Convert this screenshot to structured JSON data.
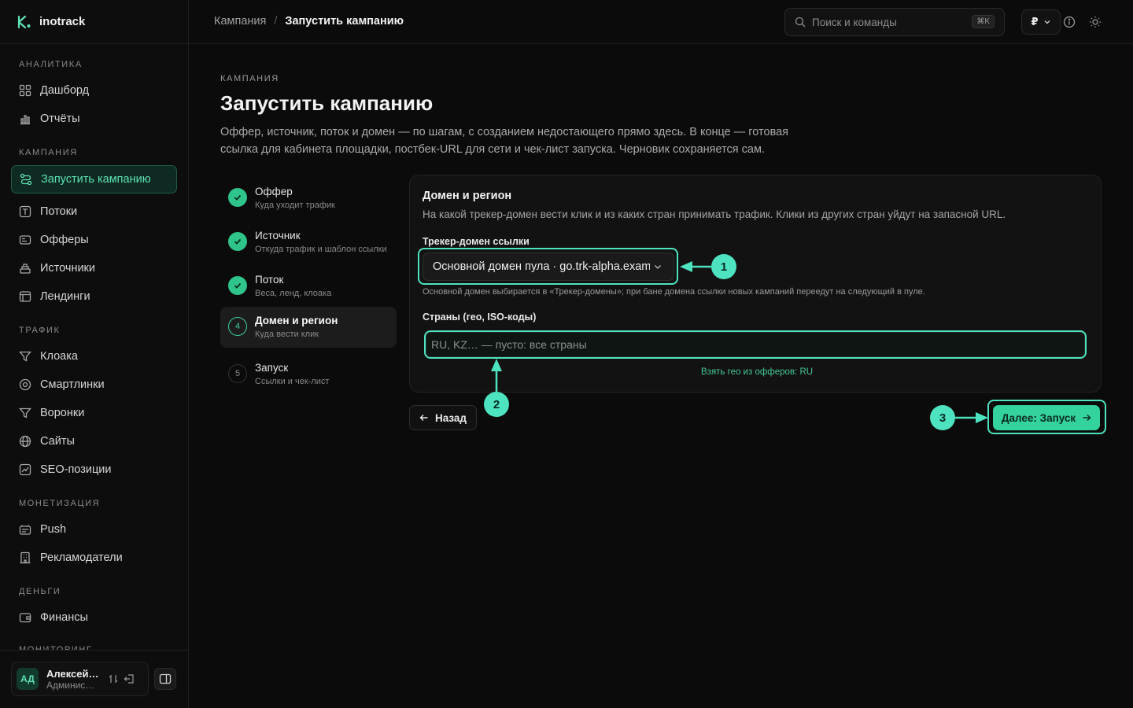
{
  "app": {
    "name": "inotrack"
  },
  "breadcrumb": {
    "parent": "Кампания",
    "separator": "/",
    "current": "Запустить кампанию"
  },
  "search": {
    "placeholder": "Поиск и команды",
    "shortcut": "⌘K"
  },
  "currency": {
    "symbol": "₽"
  },
  "sidebar": {
    "sections": [
      {
        "label": "АНАЛИТИКА",
        "items": [
          {
            "label": "Дашборд",
            "icon": "dashboard-icon"
          },
          {
            "label": "Отчёты",
            "icon": "reports-icon"
          }
        ]
      },
      {
        "label": "КАМПАНИЯ",
        "items": [
          {
            "label": "Запустить кампанию",
            "icon": "route-icon",
            "active": true
          },
          {
            "label": "Потоки",
            "icon": "streams-icon"
          },
          {
            "label": "Офферы",
            "icon": "offers-icon"
          },
          {
            "label": "Источники",
            "icon": "sources-icon"
          },
          {
            "label": "Лендинги",
            "icon": "landings-icon"
          }
        ]
      },
      {
        "label": "ТРАФИК",
        "items": [
          {
            "label": "Клоака",
            "icon": "filter-icon"
          },
          {
            "label": "Смартлинки",
            "icon": "smartlink-icon"
          },
          {
            "label": "Воронки",
            "icon": "funnel-icon"
          },
          {
            "label": "Сайты",
            "icon": "globe-icon"
          },
          {
            "label": "SEO-позиции",
            "icon": "seo-icon"
          }
        ]
      },
      {
        "label": "МОНЕТИЗАЦИЯ",
        "items": [
          {
            "label": "Push",
            "icon": "push-icon"
          },
          {
            "label": "Рекламодатели",
            "icon": "advertisers-icon"
          }
        ]
      },
      {
        "label": "ДЕНЬГИ",
        "items": [
          {
            "label": "Финансы",
            "icon": "wallet-icon"
          }
        ]
      },
      {
        "label": "МОНИТОРИНГ",
        "items": []
      }
    ],
    "user": {
      "initials": "АД",
      "name": "Алексей…",
      "role": "Админис…"
    }
  },
  "page": {
    "eyebrow": "КАМПАНИЯ",
    "title": "Запустить кампанию",
    "lead": "Оффер, источник, поток и домен — по шагам, с созданием недостающего прямо здесь. В конце — готовая ссылка для кабинета площадки, постбек-URL для сети и чек-лист запуска. Черновик сохраняется сам."
  },
  "steps": [
    {
      "number": "1",
      "title": "Оффер",
      "subtitle": "Куда уходит трафик",
      "status": "done"
    },
    {
      "number": "2",
      "title": "Источник",
      "subtitle": "Откуда трафик и шаблон ссылки",
      "status": "done"
    },
    {
      "number": "3",
      "title": "Поток",
      "subtitle": "Веса, ленд, клоака",
      "status": "done"
    },
    {
      "number": "4",
      "title": "Домен и регион",
      "subtitle": "Куда вести клик",
      "status": "current"
    },
    {
      "number": "5",
      "title": "Запуск",
      "subtitle": "Ссылки и чек-лист",
      "status": "todo"
    }
  ],
  "form": {
    "title": "Домен и регион",
    "description": "На какой трекер-домен вести клик и из каких стран принимать трафик. Клики из других стран уйдут на запасной URL.",
    "domain_label": "Трекер-домен ссылки",
    "domain_value": "Основной домен пула · go.trk-alpha.example",
    "domain_hint": "Основной домен выбирается в «Трекер-домены»; при бане домена ссылки новых кампаний переедут на следующий в пуле.",
    "geo_label": "Страны (гео, ISO-коды)",
    "geo_placeholder": "RU, KZ… — пусто: все страны",
    "geo_suggestion": "Взять гео из офферов: RU"
  },
  "actions": {
    "back": "Назад",
    "next": "Далее: Запуск"
  },
  "annotations": [
    "1",
    "2",
    "3"
  ],
  "colors": {
    "accent": "#34d39e",
    "highlight": "#4de3c0",
    "background": "#0b0b0b"
  }
}
